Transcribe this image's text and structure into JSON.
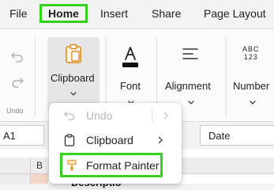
{
  "menu_bar": {
    "items": [
      "File",
      "Home",
      "Insert",
      "Share",
      "Page Layout"
    ],
    "active": "Home"
  },
  "ribbon": {
    "undo_group_label": "Undo",
    "groups": {
      "clipboard": "Clipboard",
      "font": "Font",
      "alignment": "Alignment",
      "number": "Number"
    },
    "number_icon_text": [
      "ABC",
      "123"
    ]
  },
  "formula_bar": {
    "cell_address": "A1",
    "value": "Date"
  },
  "grid": {
    "column_b": "B",
    "cell_c1_partial": "Descriptio"
  },
  "clipboard_menu": {
    "items": [
      {
        "label": "Undo",
        "icon": "undo-icon",
        "enabled": false,
        "submenu": true
      },
      {
        "label": "Clipboard",
        "icon": "clipboard-icon",
        "enabled": true,
        "submenu": true
      },
      {
        "label": "Format Painter",
        "icon": "format-painter-icon",
        "enabled": true,
        "highlighted": true
      }
    ]
  },
  "colors": {
    "highlight": "#35d21b",
    "clipboard_icon": "#e08a1e",
    "format_painter_icon": "#e5a03a"
  }
}
